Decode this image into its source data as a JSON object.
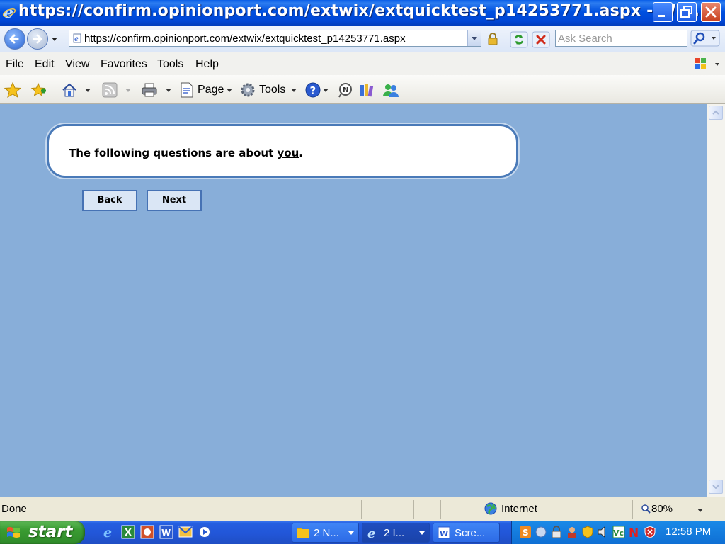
{
  "window": {
    "title": "https://confirm.opinionport.com/extwix/extquicktest_p14253771.aspx - Wi..."
  },
  "address_bar": {
    "url": "https://confirm.opinionport.com/extwix/extquicktest_p14253771.aspx"
  },
  "search": {
    "placeholder": "Ask Search"
  },
  "menu": {
    "file": "File",
    "edit": "Edit",
    "view": "View",
    "favorites": "Favorites",
    "tools": "Tools",
    "help": "Help"
  },
  "toolbar": {
    "page_label": "Page",
    "tools_label": "Tools"
  },
  "page": {
    "question_prefix": "The following questions are about ",
    "question_emphasis": "you",
    "question_suffix": ".",
    "back_label": "Back",
    "next_label": "Next"
  },
  "status": {
    "text": "Done",
    "zone": "Internet",
    "zoom": "80%"
  },
  "taskbar": {
    "start_label": "start",
    "tasks": [
      {
        "label": "2 N..."
      },
      {
        "label": "2 I..."
      },
      {
        "label": "Scre..."
      }
    ],
    "clock": "12:58 PM"
  },
  "colors": {
    "titlebar_blue": "#0050e0",
    "page_background": "#88aed9",
    "card_border": "#4a7ab8",
    "button_fill": "#dae6f5",
    "start_green": "#3a9b32"
  }
}
